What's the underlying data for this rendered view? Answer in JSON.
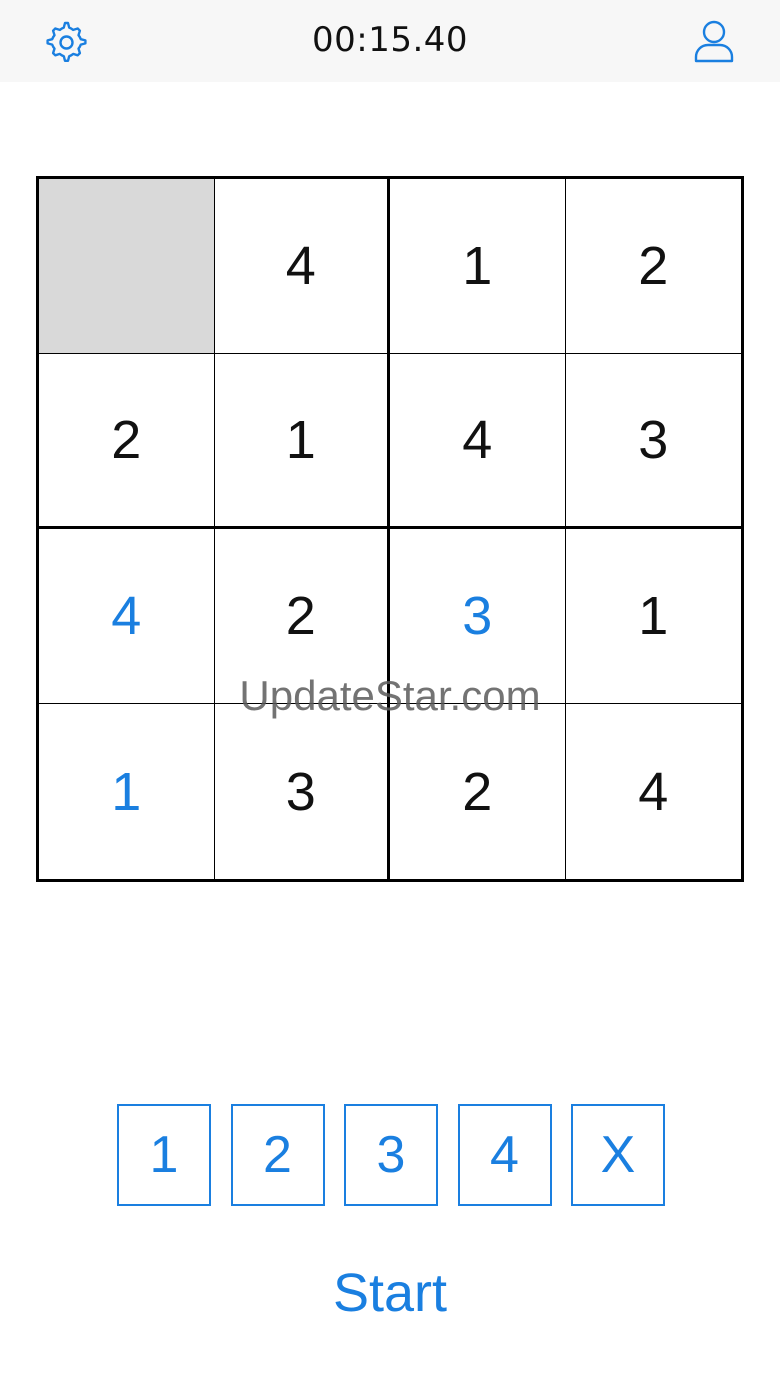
{
  "header": {
    "timer": "00:15.40",
    "settings_icon": "gear-icon",
    "profile_icon": "user-icon",
    "accent_color": "#1a7fe0"
  },
  "board": {
    "rows": [
      [
        {
          "value": "",
          "selected": true,
          "user": false
        },
        {
          "value": "4",
          "user": false
        },
        {
          "value": "1",
          "user": false
        },
        {
          "value": "2",
          "user": false
        }
      ],
      [
        {
          "value": "2",
          "user": false
        },
        {
          "value": "1",
          "user": false
        },
        {
          "value": "4",
          "user": false
        },
        {
          "value": "3",
          "user": false
        }
      ],
      [
        {
          "value": "4",
          "user": true
        },
        {
          "value": "2",
          "user": false
        },
        {
          "value": "3",
          "user": true
        },
        {
          "value": "1",
          "user": false
        }
      ],
      [
        {
          "value": "1",
          "user": true
        },
        {
          "value": "3",
          "user": false
        },
        {
          "value": "2",
          "user": false
        },
        {
          "value": "4",
          "user": false
        }
      ]
    ]
  },
  "watermark": "UpdateStar.com",
  "keypad": {
    "keys": [
      "1",
      "2",
      "3",
      "4",
      "X"
    ]
  },
  "start_label": "Start"
}
